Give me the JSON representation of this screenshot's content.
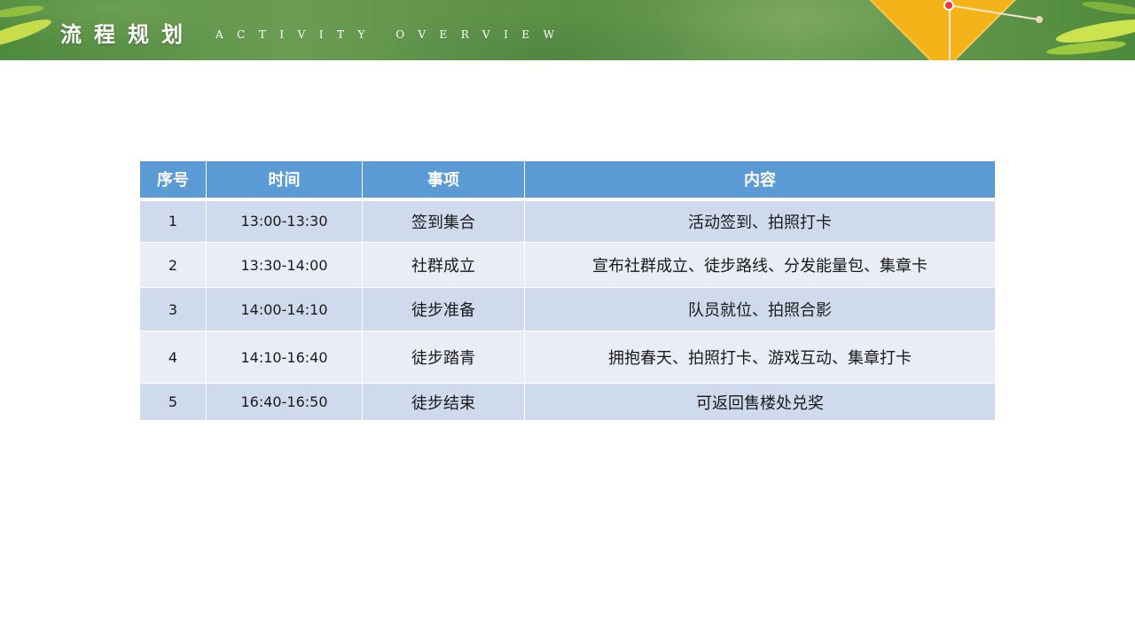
{
  "header": {
    "title": "流程规划",
    "subtitle": "ACTIVITY OVERVIEW",
    "colors": {
      "banner": "#5b8f45",
      "kite": "#f5b31a"
    },
    "icons": [
      "leaf-decoration",
      "kite-decoration"
    ]
  },
  "table": {
    "columns": [
      "序号",
      "时间",
      "事项",
      "内容"
    ],
    "rows": [
      {
        "no": "1",
        "time": "13:00-13:30",
        "item": "签到集合",
        "content": "活动签到、拍照打卡"
      },
      {
        "no": "2",
        "time": "13:30-14:00",
        "item": "社群成立",
        "content": "宣布社群成立、徒步路线、分发能量包、集章卡"
      },
      {
        "no": "3",
        "time": "14:00-14:10",
        "item": "徒步准备",
        "content": "队员就位、拍照合影"
      },
      {
        "no": "4",
        "time": "14:10-16:40",
        "item": "徒步踏青",
        "content": "拥抱春天、拍照打卡、游戏互动、集章打卡"
      },
      {
        "no": "5",
        "time": "16:40-16:50",
        "item": "徒步结束",
        "content": "可返回售楼处兑奖"
      }
    ],
    "colors": {
      "header": "#5b9bd5",
      "row_dark": "#cfdaec",
      "row_light": "#e9eef6"
    }
  }
}
